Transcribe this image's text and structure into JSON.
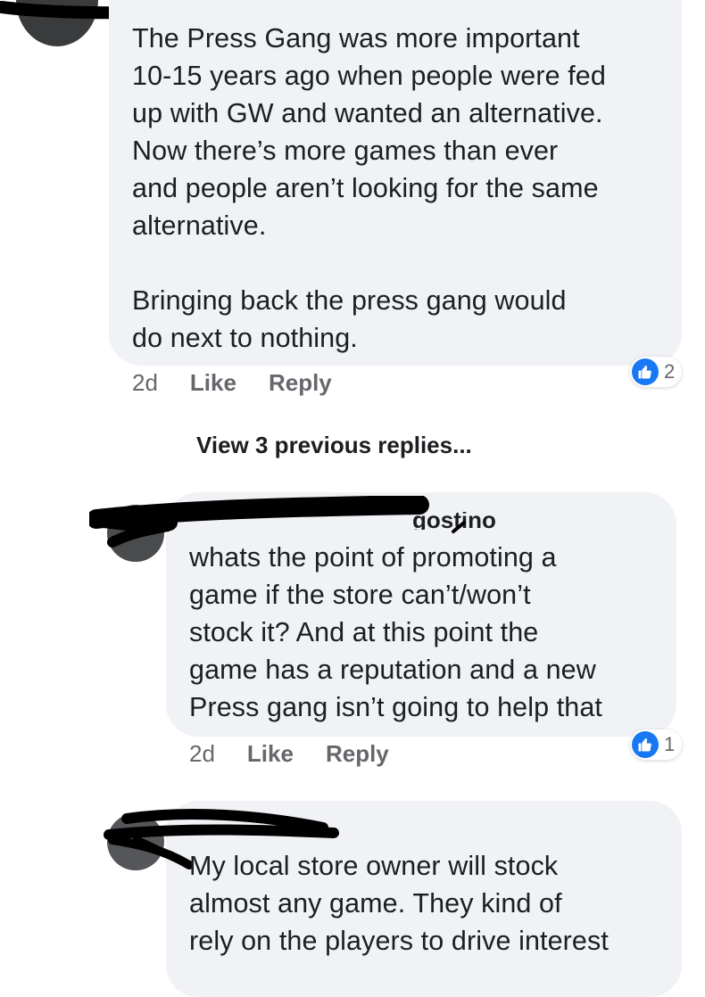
{
  "comments": [
    {
      "text": "The Press Gang was more important\n10-15 years ago when people were fed\nup with GW and wanted an alternative.\nNow there’s more games than ever\nand people aren’t looking for the same\nalternative.\n\nBringing back the press gang would\ndo next to nothing.",
      "age": "2d",
      "like_label": "Like",
      "reply_label": "Reply",
      "reaction_icon": "thumbs-up-icon",
      "reaction_count": "2"
    },
    {
      "name_fragment": "gostino",
      "text": "whats the point of promoting a\ngame if the store can’t/won’t\nstock it? And at this point the\ngame has a reputation and a new\nPress gang isn’t going to help that",
      "age": "2d",
      "like_label": "Like",
      "reply_label": "Reply",
      "reaction_icon": "thumbs-up-icon",
      "reaction_count": "1"
    },
    {
      "text": "My local store owner will stock\nalmost any game. They kind of\nrely on the players to drive interest"
    }
  ],
  "view_previous_replies": "View 3 previous replies...",
  "colors": {
    "bubble": "#f0f2f5",
    "meta_text": "#65676b",
    "like_blue": "#1877f2",
    "text": "#1c1e21"
  }
}
